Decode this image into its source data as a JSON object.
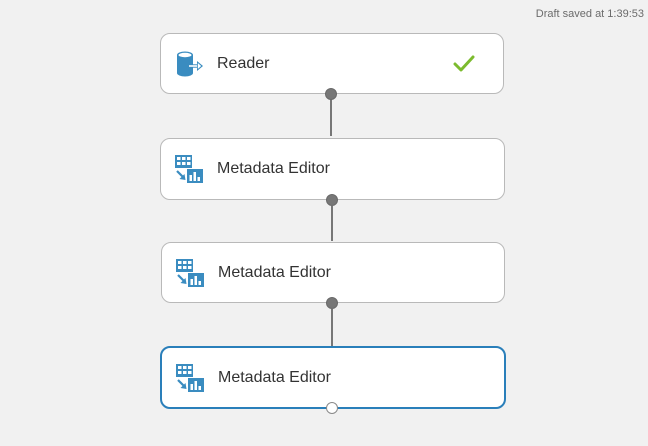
{
  "status": {
    "draft_saved": "Draft saved at 1:39:53"
  },
  "modules": [
    {
      "label": "Reader",
      "icon": "reader-icon",
      "status": "completed-check-icon"
    },
    {
      "label": "Metadata Editor",
      "icon": "metadata-editor-icon"
    },
    {
      "label": "Metadata Editor",
      "icon": "metadata-editor-icon"
    },
    {
      "label": "Metadata Editor",
      "icon": "metadata-editor-icon",
      "selected": true
    }
  ],
  "colors": {
    "icon_blue": "#3a8cc0",
    "check_green": "#7cbb2e",
    "selected_border": "#2a7fba",
    "connector": "#777777"
  }
}
